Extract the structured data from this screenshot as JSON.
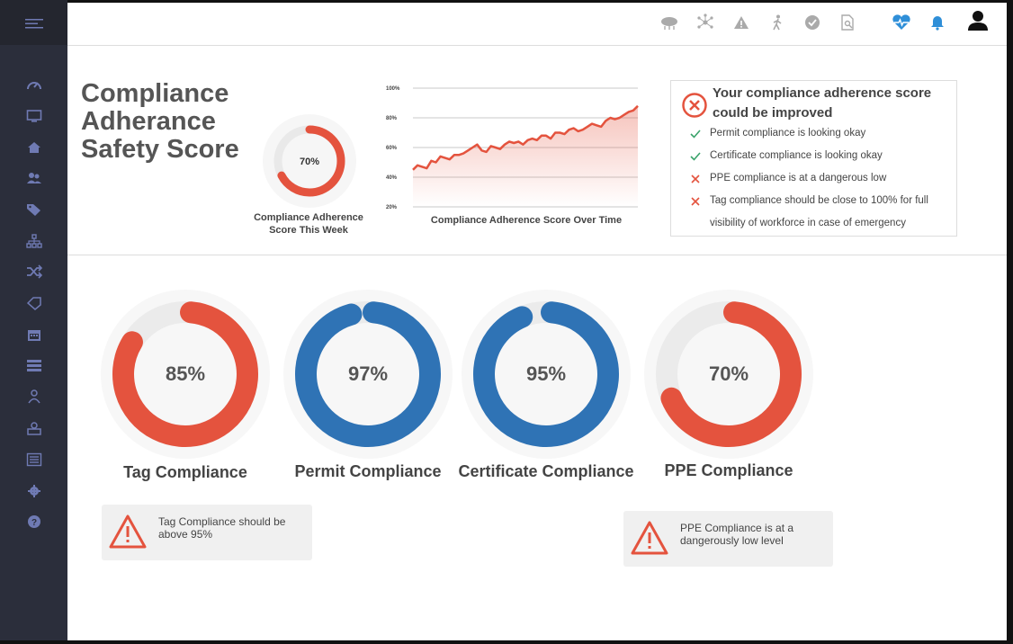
{
  "header": {
    "title_lines": [
      "Compliance",
      "Adherance",
      "Safety Score"
    ],
    "icons": [
      "cloud-icon",
      "network-icon",
      "warning-icon",
      "walking-person-icon",
      "check-circle-icon",
      "document-search-icon",
      "heart-pulse-icon",
      "bell-icon",
      "user-icon"
    ]
  },
  "sidebar": {
    "icons": [
      "menu-icon",
      "dashboard-icon",
      "monitor-icon",
      "home-icon",
      "users-icon",
      "tags-icon",
      "org-chart-icon",
      "shuffle-icon",
      "tag-outline-icon",
      "calendar-icon",
      "list-icon",
      "person-icon",
      "badge-icon",
      "table-icon",
      "gear-icon",
      "help-icon"
    ]
  },
  "weekly_score": {
    "value_label": "70%",
    "value": 70,
    "caption_line1": "Compliance Adherence",
    "caption_line2": "Score This Week"
  },
  "chart_data": {
    "type": "area",
    "title": "Compliance Adherence Score Over Time",
    "yticks": [
      "100%",
      "80%",
      "60%",
      "40%",
      "20%"
    ],
    "x": [
      0,
      1,
      2,
      3,
      4,
      5,
      6,
      7,
      8,
      9,
      10,
      11,
      12,
      13,
      14,
      15,
      16,
      17,
      18,
      19,
      20,
      21,
      22,
      23,
      24,
      25,
      26,
      27,
      28,
      29,
      30,
      31,
      32,
      33,
      34,
      35,
      36,
      37,
      38,
      39,
      40,
      41,
      42,
      43,
      44,
      45,
      46,
      47,
      48,
      49
    ],
    "values": [
      45,
      48,
      47,
      46,
      51,
      50,
      54,
      53,
      52,
      55,
      55,
      56,
      58,
      60,
      62,
      58,
      57,
      61,
      60,
      59,
      62,
      64,
      63,
      64,
      62,
      65,
      66,
      65,
      68,
      68,
      66,
      70,
      70,
      69,
      72,
      73,
      71,
      72,
      74,
      76,
      75,
      74,
      78,
      80,
      79,
      80,
      82,
      84,
      85,
      88
    ],
    "ylim": [
      20,
      100
    ],
    "color": "#e4533e"
  },
  "panel": {
    "heading": "Your compliance adherence score could be improved",
    "items": [
      {
        "status": "ok",
        "text": "Permit compliance is looking okay"
      },
      {
        "status": "ok",
        "text": "Certificate compliance is looking okay"
      },
      {
        "status": "bad",
        "text": "PPE compliance is at a dangerous low"
      },
      {
        "status": "bad",
        "text": "Tag compliance should be close to 100% for full"
      },
      {
        "status": "none",
        "text": "visibility of workforce in case of emergency"
      }
    ]
  },
  "gauges": [
    {
      "label": "Tag Compliance",
      "value_label": "85%",
      "value": 85,
      "color": "#e4533e"
    },
    {
      "label": "Permit Compliance",
      "value_label": "97%",
      "value": 97,
      "color": "#2f73b5"
    },
    {
      "label": "Certificate Compliance",
      "value_label": "95%",
      "value": 95,
      "color": "#2f73b5"
    },
    {
      "label": "PPE Compliance",
      "value_label": "70%",
      "value": 70,
      "color": "#e4533e"
    }
  ],
  "warnings": [
    {
      "text": "Tag Compliance should be above 95%"
    },
    {
      "text": "PPE Compliance is at a dangerously low level"
    }
  ],
  "colors": {
    "red": "#e4533e",
    "blue": "#2f73b5",
    "green": "#3aa36b",
    "sidebar": "#2b2e3b"
  }
}
